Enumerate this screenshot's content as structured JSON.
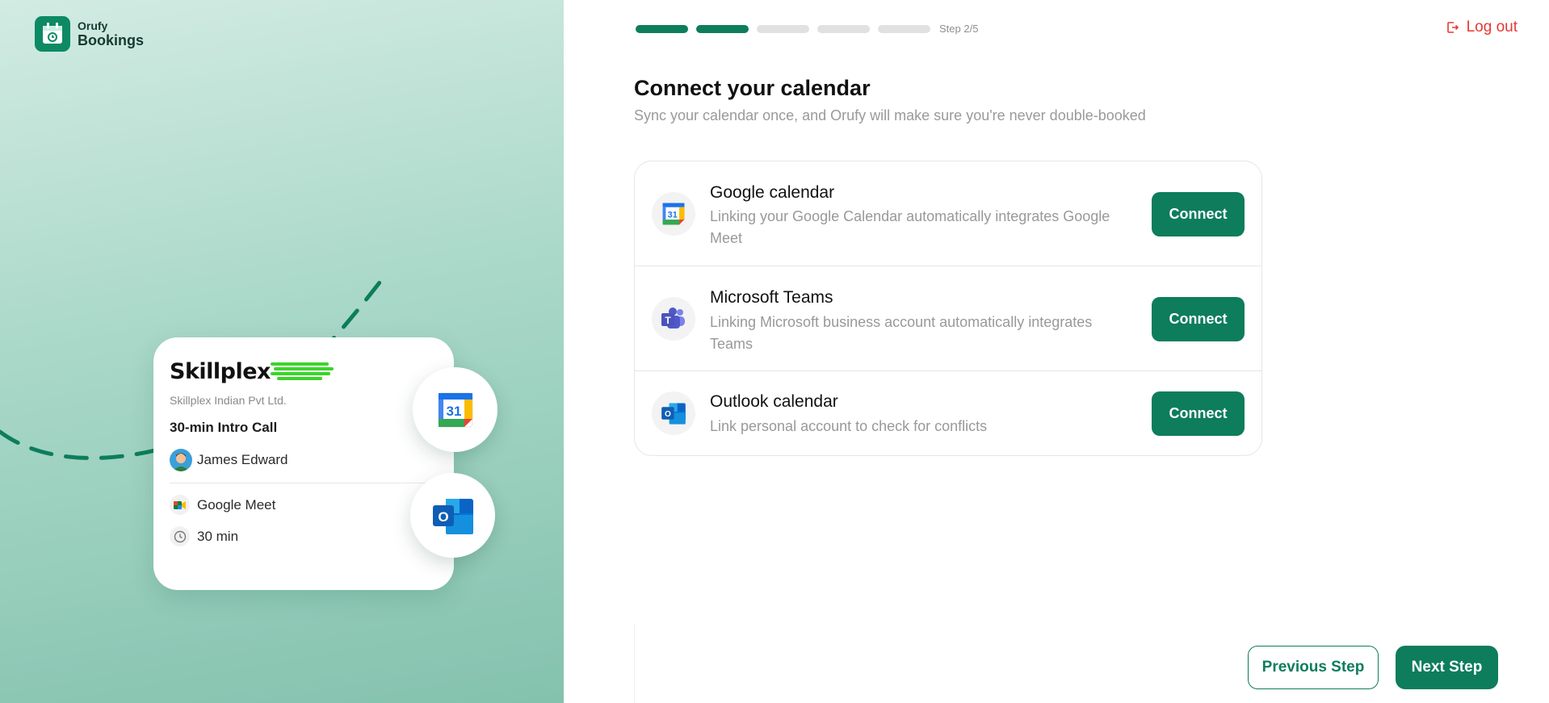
{
  "brand": {
    "top": "Orufy",
    "bottom": "Bookings",
    "accent": "#0d8a64"
  },
  "preview_card": {
    "company_logo_text": "Skillplex",
    "company_name": "Skillplex Indian Pvt Ltd.",
    "event_title": "30-min Intro Call",
    "host_name": "James Edward",
    "location": "Google Meet",
    "duration": "30 min",
    "badges": [
      "google-calendar-icon",
      "outlook-icon"
    ]
  },
  "progress": {
    "total_steps": 5,
    "completed_steps": 2,
    "label": "Step 2/5",
    "done_color": "#0d7d5c",
    "todo_color": "#e1e1e1"
  },
  "header": {
    "logout_label": "Log out",
    "logout_color": "#e53935"
  },
  "main": {
    "title": "Connect your calendar",
    "subtitle": "Sync your calendar once, and Orufy will make sure you're never double-booked"
  },
  "providers": [
    {
      "icon": "google-calendar-icon",
      "title": "Google calendar",
      "description": "Linking your Google Calendar automatically integrates Google Meet",
      "button": "Connect"
    },
    {
      "icon": "microsoft-teams-icon",
      "title": "Microsoft Teams",
      "description": "Linking Microsoft business account automatically integrates Teams",
      "button": "Connect"
    },
    {
      "icon": "outlook-icon",
      "title": "Outlook calendar",
      "description": "Link personal account to check for conflicts",
      "button": "Connect"
    }
  ],
  "footer": {
    "previous_label": "Previous Step",
    "next_label": "Next Step"
  },
  "colors": {
    "primary": "#0d7d5c",
    "danger": "#e53935"
  }
}
